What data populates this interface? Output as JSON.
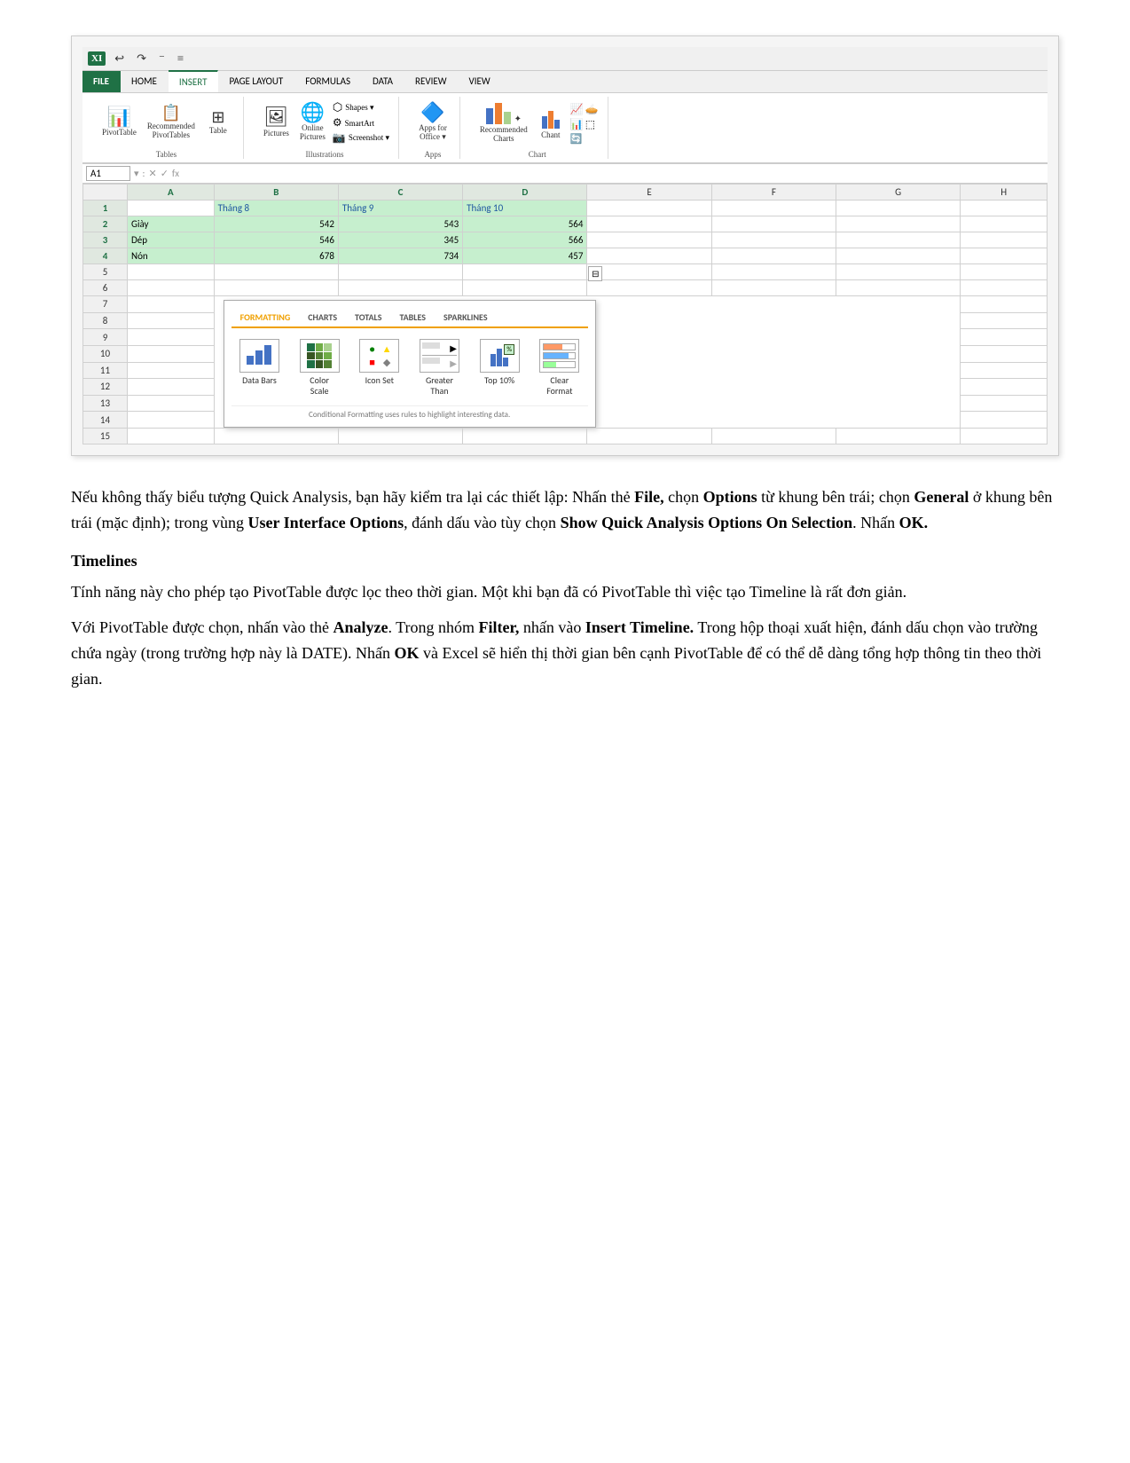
{
  "ribbon": {
    "excel_icon": "XI",
    "title_buttons": [
      "⟵",
      "↷",
      "⁻",
      "≡"
    ],
    "tabs": [
      "FILE",
      "HOME",
      "INSERT",
      "PAGE LAYOUT",
      "FORMULAS",
      "DATA",
      "REVIEW",
      "VIEW"
    ],
    "active_tab": "INSERT",
    "groups": {
      "tables": {
        "label": "Tables",
        "items": [
          "PivotTable",
          "Recommended PivotTables",
          "Table"
        ]
      },
      "illustrations": {
        "label": "Illustrations",
        "items": [
          "Pictures",
          "Online Pictures",
          "Shapes ▾",
          "SmartArt",
          "Screenshot ▾"
        ]
      },
      "apps": {
        "label": "Apps",
        "items": [
          "Apps for Office ▾"
        ]
      },
      "charts": {
        "label": "Chart",
        "items": [
          "Recommended Charts",
          "Chant"
        ]
      }
    }
  },
  "formula_bar": {
    "cell_ref": "A1",
    "sep1": "▾",
    "sep2": ":",
    "cancel": "✕",
    "confirm": "✓",
    "fx": "fx"
  },
  "spreadsheet": {
    "col_headers": [
      "",
      "A",
      "B",
      "C",
      "D",
      "E",
      "F",
      "G",
      "H"
    ],
    "rows": [
      {
        "row": "1",
        "A": "",
        "B": "Tháng 8",
        "C": "Tháng 9",
        "D": "Tháng 10",
        "E": "",
        "F": "",
        "G": "",
        "H": ""
      },
      {
        "row": "2",
        "A": "Giày",
        "B": "542",
        "C": "543",
        "D": "564",
        "E": "",
        "F": "",
        "G": "",
        "H": ""
      },
      {
        "row": "3",
        "A": "Dép",
        "B": "546",
        "C": "345",
        "D": "566",
        "E": "",
        "F": "",
        "G": "",
        "H": ""
      },
      {
        "row": "4",
        "A": "Nón",
        "B": "678",
        "C": "734",
        "D": "457",
        "E": "",
        "F": "",
        "G": "",
        "H": ""
      },
      {
        "row": "5",
        "A": "",
        "B": "",
        "C": "",
        "D": "",
        "E": "",
        "F": "",
        "G": "",
        "H": ""
      },
      {
        "row": "6",
        "A": "",
        "B": "",
        "C": "",
        "D": "",
        "E": "",
        "F": "",
        "G": "",
        "H": ""
      },
      {
        "row": "7",
        "A": "",
        "B": "",
        "C": "",
        "D": "",
        "E": "",
        "F": "",
        "G": "",
        "H": ""
      },
      {
        "row": "8",
        "A": "",
        "B": "",
        "C": "",
        "D": "",
        "E": "",
        "F": "",
        "G": "",
        "H": ""
      },
      {
        "row": "9",
        "A": "",
        "B": "",
        "C": "",
        "D": "",
        "E": "",
        "F": "",
        "G": "",
        "H": ""
      },
      {
        "row": "10",
        "A": "",
        "B": "",
        "C": "",
        "D": "",
        "E": "",
        "F": "",
        "G": "",
        "H": ""
      },
      {
        "row": "11",
        "A": "",
        "B": "",
        "C": "",
        "D": "",
        "E": "",
        "F": "",
        "G": "",
        "H": ""
      },
      {
        "row": "12",
        "A": "",
        "B": "",
        "C": "",
        "D": "",
        "E": "",
        "F": "",
        "G": "",
        "H": ""
      },
      {
        "row": "13",
        "A": "",
        "B": "",
        "C": "",
        "D": "",
        "E": "",
        "F": "",
        "G": "",
        "H": ""
      },
      {
        "row": "14",
        "A": "",
        "B": "",
        "C": "",
        "D": "",
        "E": "",
        "F": "",
        "G": "",
        "H": ""
      },
      {
        "row": "15",
        "A": "",
        "B": "",
        "C": "",
        "D": "",
        "E": "",
        "F": "",
        "G": "",
        "H": ""
      }
    ],
    "qa_icon": "⊟",
    "qa_tabs": [
      "FORMATTING",
      "CHARTS",
      "TOTALS",
      "TABLES",
      "SPARKLINES"
    ],
    "qa_active_tab": "FORMATTING",
    "qa_items": [
      {
        "label": "Data Bars",
        "icon": "databars"
      },
      {
        "label": "Color Scale",
        "icon": "colorscale"
      },
      {
        "label": "Icon Set",
        "icon": "iconset"
      },
      {
        "label": "Greater Than",
        "icon": "greaterthan"
      },
      {
        "label": "Top 10%",
        "icon": "top10"
      },
      {
        "label": "Clear Format",
        "icon": "clearformat"
      }
    ],
    "qa_footer": "Conditional Formatting uses rules to highlight interesting data."
  },
  "body": {
    "para1": "Nếu không thấy biểu tượng Quick Analysis, bạn hãy kiểm tra lại các thiết lập: Nhấn thẻ ",
    "para1_file": "File,",
    "para1_b": " chọn ",
    "para1_options": "Options",
    "para1_c": " từ khung bên trái; chọn ",
    "para1_general": "General",
    "para1_d": " ở khung bên trái (mặc định); trong vùng ",
    "para1_uio": "User Interface Options",
    "para1_e": ", đánh dấu vào tùy chọn ",
    "para1_show": "Show Quick Analysis Options On Selection",
    "para1_f": ". Nhấn ",
    "para1_ok": "OK.",
    "heading_timelines": "Timelines",
    "para2": "Tính năng này cho phép tạo PivotTable được lọc theo thời gian. Một khi bạn đã có PivotTable thì việc tạo Timeline là rất đơn giản.",
    "para3_a": "Với PivotTable được chọn, nhấn vào thẻ ",
    "para3_analyze": "Analyze",
    "para3_b": ". Trong nhóm ",
    "para3_filter": "Filter,",
    "para3_c": " nhấn vào ",
    "para3_insert": "Insert Timeline.",
    "para3_d": " Trong hộp thoại xuất hiện, đánh dấu chọn vào trường chứa ngày (trong trường hợp này là DATE). Nhấn ",
    "para3_ok": "OK",
    "para3_e": " và Excel sẽ hiển thị thời gian bên cạnh PivotTable để có thể dễ dàng tổng hợp thông tin theo thời gian."
  }
}
